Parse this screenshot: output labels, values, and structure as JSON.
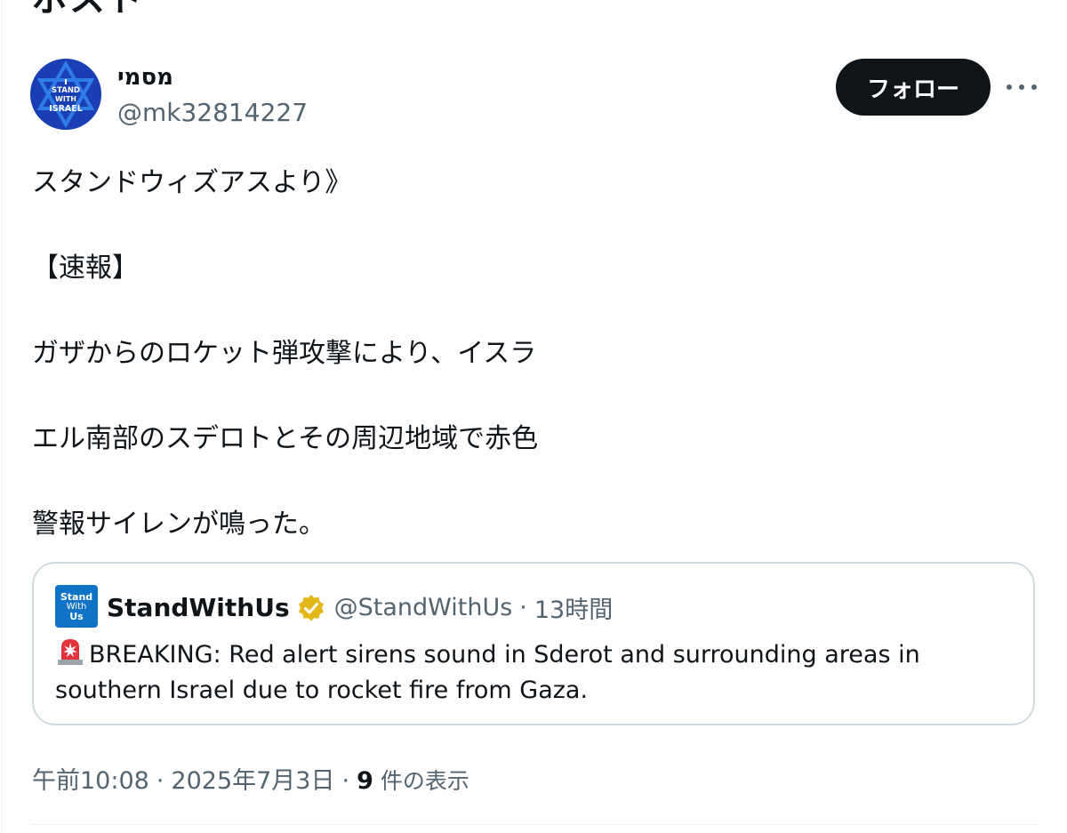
{
  "header": {
    "title": "ポスト"
  },
  "author": {
    "avatar_text": [
      "STAND",
      "WITH",
      "ISRAEL"
    ],
    "name": "מסמי",
    "handle": "@mk32814227",
    "follow_label": "フォロー",
    "more_icon": "more-horizontal-icon"
  },
  "tweet": {
    "lines": [
      "スタンドウィズアスより》",
      "【速報】",
      "ガザからのロケット弾攻撃により、イスラ",
      "エル南部のスデロトとその周辺地域で赤色",
      "警報サイレンが鳴った。"
    ]
  },
  "quote": {
    "avatar_text": [
      "Stand",
      "With",
      "Us"
    ],
    "name": "StandWithUs",
    "handle": "@StandWithUs",
    "separator": "·",
    "time": "13時間",
    "body": "BREAKING: Red alert sirens sound in Sderot and surrounding areas in southern Israel due to rocket fire from Gaza.",
    "siren_icon": "police-light-emoji"
  },
  "meta": {
    "time": "午前10:08",
    "date": "2025年7月3日",
    "separator": "·",
    "views_count": "9",
    "views_label": "件の表示"
  },
  "colors": {
    "text": "#0f1419",
    "secondary": "#536471",
    "border": "#cfd9de",
    "verified_gold": "#e2b719",
    "follow_bg": "#0f1419"
  }
}
